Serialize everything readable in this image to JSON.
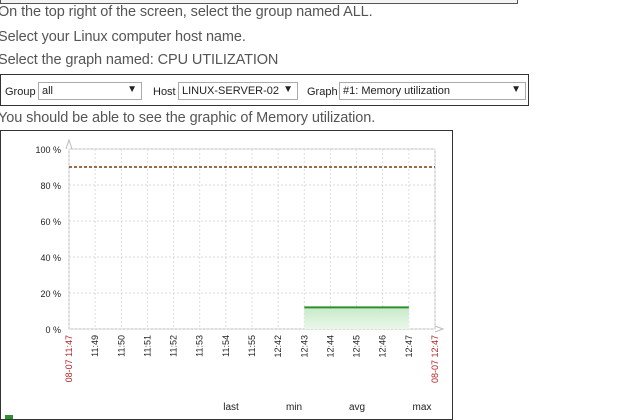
{
  "instructions": [
    "On the top right of the screen, select the group named ALL.",
    "Select your Linux computer host name.",
    "Select the graph named: CPU UTILIZATION"
  ],
  "filter": {
    "group_label": "Group",
    "group_value": "all",
    "host_label": "Host",
    "host_value": "LINUX-SERVER-02",
    "graph_label": "Graph",
    "graph_value": "#1: Memory utilization"
  },
  "note": "You should be able to see the graphic of Memory utilization.",
  "chart_data": {
    "type": "area",
    "y_ticks": [
      "100 %",
      "80 %",
      "60 %",
      "40 %",
      "20 %",
      "0 %"
    ],
    "ylim": [
      0,
      100
    ],
    "x_ticks": [
      "11:49",
      "11:50",
      "11:51",
      "11:52",
      "11:53",
      "11:54",
      "11:55",
      "12:42",
      "12:43",
      "12:44",
      "12:45",
      "12:46",
      "12:47"
    ],
    "x_start_label": "08-07 11:47",
    "x_end_label": "08-07 12:47",
    "threshold_line_value": 90,
    "series": [
      {
        "values_by_tick": [
          null,
          null,
          null,
          null,
          null,
          null,
          null,
          null,
          12,
          12,
          12,
          12,
          12
        ],
        "color": "#2f8f2f",
        "fill": "#c8eac8"
      }
    ],
    "legend": {
      "headers": [
        "last",
        "min",
        "avg",
        "max"
      ]
    },
    "grid": true
  }
}
